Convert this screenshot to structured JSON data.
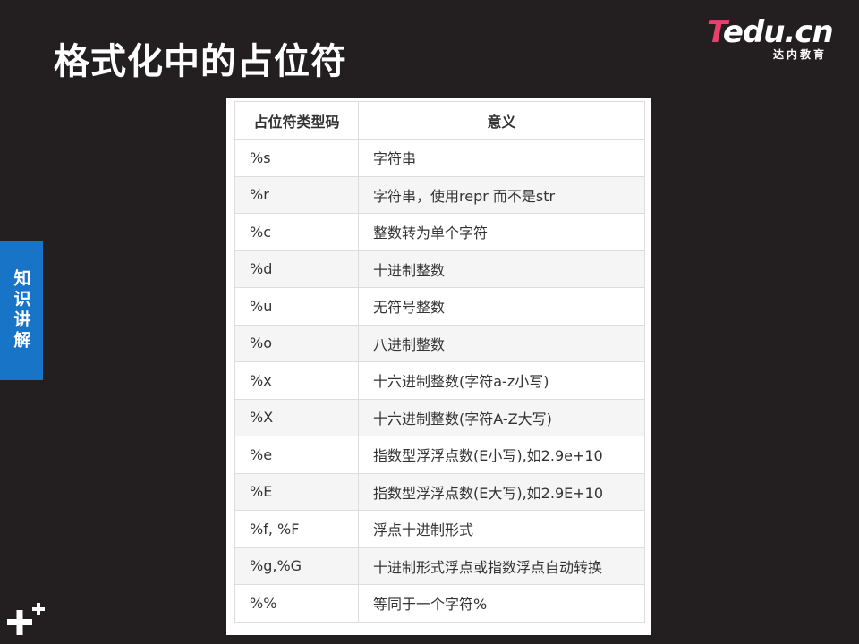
{
  "slide": {
    "title": "格式化中的占位符",
    "side_tab": "知识讲解"
  },
  "logo": {
    "t": "T",
    "edu": "edu",
    "cn": ".cn",
    "sub": "达内教育"
  },
  "colors": {
    "background": "#231f20",
    "side_tab": "#1874c7",
    "logo_accent": "#e8406b"
  },
  "table": {
    "headers": [
      "占位符类型码",
      "意义"
    ],
    "rows": [
      [
        "%s",
        "字符串"
      ],
      [
        "%r",
        "字符串，使用repr 而不是str"
      ],
      [
        "%c",
        "整数转为单个字符"
      ],
      [
        "%d",
        "十进制整数"
      ],
      [
        "%u",
        "无符号整数"
      ],
      [
        "%o",
        "八进制整数"
      ],
      [
        "%x",
        "十六进制整数(字符a-z小写)"
      ],
      [
        "%X",
        "十六进制整数(字符A-Z大写)"
      ],
      [
        "%e",
        "指数型浮浮点数(E小写),如2.9e+10"
      ],
      [
        "%E",
        "指数型浮浮点数(E大写),如2.9E+10"
      ],
      [
        "%f, %F",
        "浮点十进制形式"
      ],
      [
        "%g,%G",
        "十进制形式浮点或指数浮点自动转换"
      ],
      [
        "%%",
        "等同于一个字符%"
      ]
    ]
  },
  "icons": {
    "corner": "plus-plus-icon"
  }
}
